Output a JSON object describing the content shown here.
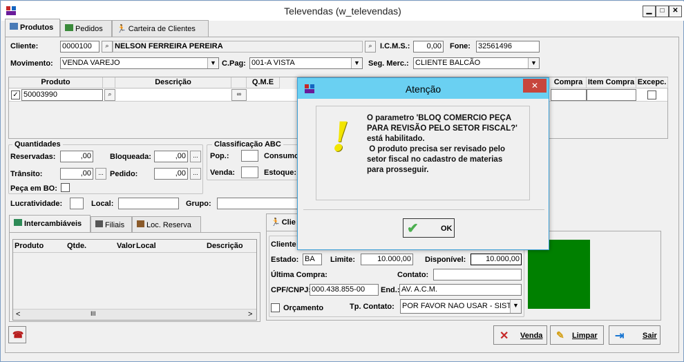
{
  "window": {
    "title": "Televendas (w_televendas)",
    "minimize": "▁",
    "maximize": "□",
    "close": "✕"
  },
  "tabs": [
    {
      "label": "Produtos"
    },
    {
      "label": "Pedidos"
    },
    {
      "label": "Carteira de Clientes"
    }
  ],
  "header": {
    "cliente_label": "Cliente:",
    "cliente_code": "0000100",
    "cliente_name": "NELSON FERREIRA PEREIRA",
    "icms_label": "I.C.M.S.:",
    "icms_value": "0,00",
    "fone_label": "Fone:",
    "fone_value": "32561496",
    "movimento_label": "Movimento:",
    "movimento_value": "VENDA VAREJO",
    "cpag_label": "C.Pag:",
    "cpag_value": "001-A VISTA",
    "segmerc_label": "Seg. Merc.:",
    "segmerc_value": "CLIENTE BALCÃO"
  },
  "grid": {
    "columns": [
      "Produto",
      "Descrição",
      "Q.M.E",
      "Compra",
      "Item Compra",
      "Excepc."
    ],
    "rows": [
      {
        "produto": "50003990",
        "checked": "✓"
      }
    ]
  },
  "quantidades": {
    "title": "Quantidades",
    "reservadas_label": "Reservadas:",
    "reservadas_value": ",00",
    "bloqueada_label": "Bloqueada:",
    "bloqueada_value": ",00",
    "transito_label": "Trânsito:",
    "transito_value": ",00",
    "pedido_label": "Pedido:",
    "pedido_value": ",00",
    "pecabo_label": "Peça em BO:",
    "more": "..."
  },
  "abc": {
    "title": "Classificação ABC",
    "pop_label": "Pop.:",
    "consumo_label": "Consumo",
    "venda_label": "Venda:",
    "estoque_label": "Estoque:"
  },
  "misc": {
    "lucratividade_label": "Lucratividade:",
    "local_label": "Local:",
    "grupo_label": "Grupo:"
  },
  "lower_tabs": [
    {
      "label": "Intercambiáveis"
    },
    {
      "label": "Filiais"
    },
    {
      "label": "Loc. Reserva"
    }
  ],
  "lower_grid": {
    "columns": [
      "Produto",
      "Qtde.",
      "Valor",
      "Local",
      "Descrição"
    ],
    "scroll_left": "<",
    "scroll_right": ">",
    "scroll_thumb": "III"
  },
  "client_panel": {
    "tab_label": "Clie",
    "cliente_label": "Cliente",
    "estado_label": "Estado:",
    "estado_value": "BA",
    "limite_label": "Limite:",
    "limite_value": "10.000,00",
    "disponivel_label": "Disponível:",
    "disponivel_value": "10.000,00",
    "ultima_label": "Última Compra:",
    "contato_label": "Contato:",
    "cpf_label": "CPF/CNPJ:",
    "cpf_value": "000.438.855-00",
    "end_label": "End.:",
    "end_value": "AV. A.C.M.",
    "orcamento_label": "Orçamento",
    "tpcontato_label": "Tp. Contato:",
    "tpcontato_value": "POR FAVOR NAO USAR - SIST"
  },
  "buttons": {
    "venda": "Venda",
    "limpar": "Limpar",
    "sair": "Sair"
  },
  "dialog": {
    "title": "Atenção",
    "close": "✕",
    "message": [
      "O parametro 'BLOQ COMERCIO PEÇA",
      "PARA REVISÃO PELO SETOR FISCAL?'",
      "está habilitado.",
      " O produto precisa ser revisado pelo",
      "setor fiscal no cadastro de materias",
      "para prosseguir."
    ],
    "ok": "OK",
    "icon_glyph": "!"
  },
  "colors": {
    "accent": "#6ad0f2",
    "green_panel": "#008000",
    "dialog_close": "#c7463d"
  }
}
